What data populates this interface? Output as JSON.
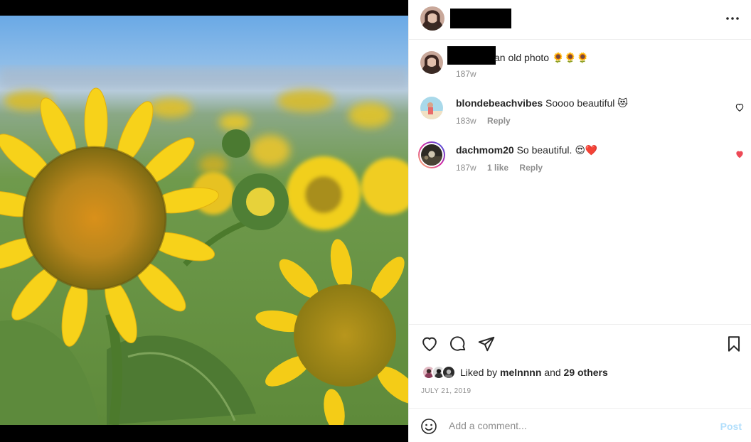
{
  "post": {
    "author_redacted": true
  },
  "caption": {
    "text": "an old photo 🌻🌻🌻",
    "time": "187w"
  },
  "comments": [
    {
      "user": "blondebeachvibes",
      "text": "Soooo beautiful 😻",
      "time": "183w",
      "likes": "",
      "reply": "Reply",
      "liked": false
    },
    {
      "user": "dachmom20",
      "text": "So beautiful. 😍❤️",
      "time": "187w",
      "likes": "1 like",
      "reply": "Reply",
      "liked": true
    }
  ],
  "likes": {
    "prefix": "Liked by ",
    "user": "melnnnn",
    "middle": " and ",
    "others": "29 others"
  },
  "date": "JULY 21, 2019",
  "add_comment": {
    "placeholder": "Add a comment...",
    "post_label": "Post"
  },
  "icons": {
    "more": "more-horizontal-icon",
    "like": "heart-icon",
    "comment": "comment-bubble-icon",
    "share": "paper-plane-icon",
    "save": "bookmark-icon",
    "emoji": "emoji-smile-icon",
    "liked_heart": "heart-filled-icon"
  },
  "colors": {
    "liked_red": "#ed4956",
    "post_disabled": "#b2dffc",
    "meta_gray": "#8e8e8e",
    "story_ring_start": "#d6249f",
    "story_ring_end": "#fd5949"
  }
}
